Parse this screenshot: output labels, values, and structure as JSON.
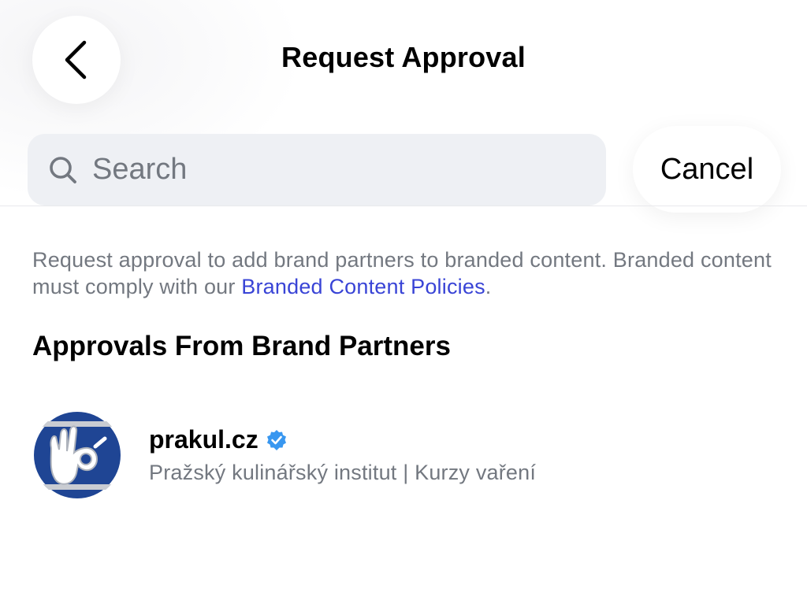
{
  "header": {
    "title": "Request Approval",
    "back_icon": "chevron-left-icon"
  },
  "search": {
    "placeholder": "Search",
    "value": "",
    "icon": "search-icon",
    "cancel_label": "Cancel"
  },
  "description": {
    "text": "Request approval to add brand partners to branded content. Branded content must comply with our ",
    "link_text": "Branded Content Policies",
    "suffix": "."
  },
  "section": {
    "heading": "Approvals From Brand Partners"
  },
  "accounts": [
    {
      "username": "prakul.cz",
      "verified": true,
      "full_name": "Pražský kulinářský institut | Kurzy vaření",
      "avatar_icon": "ok-hand-logo"
    }
  ],
  "colors": {
    "link": "#3944d6",
    "secondary_text": "#737880",
    "search_bg": "#eef0f4",
    "verified_badge": "#3897f0",
    "avatar_blue": "#1f4594"
  }
}
